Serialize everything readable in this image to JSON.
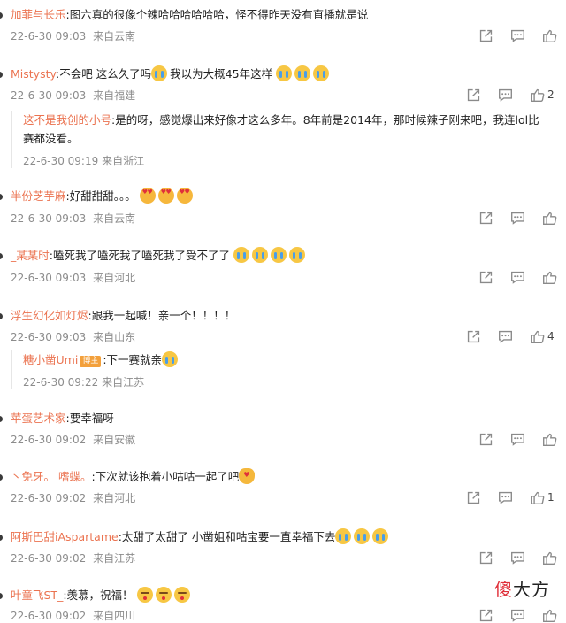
{
  "comments": [
    {
      "user": "加菲与长乐",
      "text": ":图六真的很像个辣哈哈哈哈哈哈，怪不得昨天没有直播就是说",
      "date": "22-6-30 09:03",
      "location": "来自云南",
      "likes": ""
    },
    {
      "user": "Mistysty",
      "text": ":不会吧 这么久了吗",
      "text_after": "我以为大概45年这样",
      "date": "22-6-30 09:03",
      "location": "来自福建",
      "likes": "2",
      "reply": {
        "user": "这不是我创的小号",
        "text": ":是的呀，感觉爆出来好像才这么多年。8年前是2014年，那时候辣子刚来吧，我连lol比赛都没看。",
        "date": "22-6-30 09:19",
        "location": "来自浙江"
      }
    },
    {
      "user": "半份芝芋麻",
      "text": ":好甜甜甜。。。",
      "date": "22-6-30 09:03",
      "location": "来自云南",
      "likes": ""
    },
    {
      "user": "_某某时",
      "text": ":嗑死我了嗑死我了嗑死我了受不了了",
      "date": "22-6-30 09:03",
      "location": "来自河北",
      "likes": ""
    },
    {
      "user": "浮生幻化如灯烬",
      "text": ":跟我一起喊！亲一个！！！！",
      "date": "22-6-30 09:03",
      "location": "来自山东",
      "likes": "4",
      "reply": {
        "user": "糖小凿Umi",
        "badge": "博主",
        "text": ":下一赛就亲",
        "date": "22-6-30 09:22",
        "location": "来自江苏"
      }
    },
    {
      "user": "苹蛋艺术家",
      "text": ":要幸福呀",
      "date": "22-6-30 09:02",
      "location": "来自安徽",
      "likes": ""
    },
    {
      "user": "丶免牙。 嗜蝶。",
      "text": ":下次就该抱着小咕咕一起了吧",
      "date": "22-6-30 09:02",
      "location": "来自河北",
      "likes": "1"
    },
    {
      "user": "阿斯巴甜iAspartame",
      "text": ":太甜了太甜了 小凿姐和咕宝要一直幸福下去",
      "date": "22-6-30 09:02",
      "location": "来自江苏",
      "likes": ""
    },
    {
      "user": "叶童飞ST_",
      "text": ":羡慕，祝福！",
      "date": "22-6-30 09:02",
      "location": "来自四川",
      "likes": ""
    }
  ],
  "watermark": {
    "first": "傻",
    "rest": "大方"
  },
  "icons": {
    "share": "share-icon",
    "comment": "comment-icon",
    "like": "thumbs-up-icon"
  },
  "colors": {
    "username": "#eb7350",
    "meta": "#8c8c8c",
    "badge": "#f3a03b"
  }
}
